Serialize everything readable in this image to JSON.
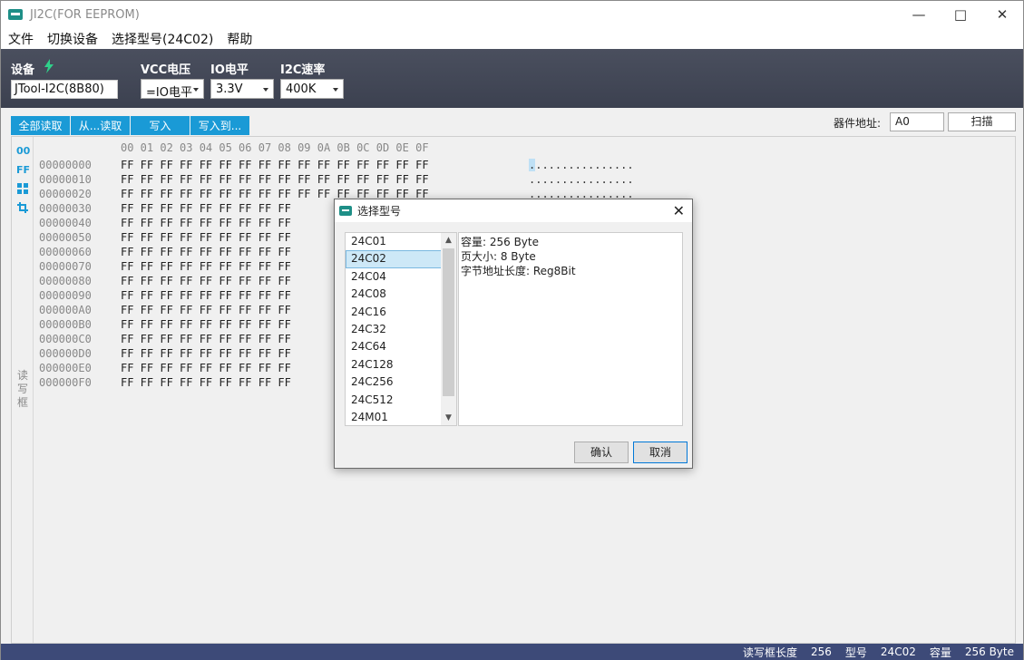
{
  "window": {
    "title": "JI2C(FOR EEPROM)"
  },
  "menu": [
    "文件",
    "切换设备",
    "选择型号(24C02)",
    "帮助"
  ],
  "toolbar": {
    "device_label": "设备",
    "device_value": "JTool-I2C(8B80)",
    "vcc_label": "VCC电压",
    "vcc_value": "=IO电平",
    "io_label": "IO电平",
    "io_value": "3.3V",
    "rate_label": "I2C速率",
    "rate_value": "400K"
  },
  "actions": {
    "read_all": "全部读取",
    "read_from": "从...读取",
    "write": "写入",
    "write_to": "写入到..."
  },
  "address": {
    "label": "器件地址:",
    "value": "A0",
    "scan": "扫描"
  },
  "side": {
    "ico1": "00",
    "ico2": "FF",
    "rw_box": "读写框"
  },
  "hex": {
    "header": "00 01 02 03 04 05 06 07 08 09 0A 0B 0C 0D 0E 0F",
    "rows": [
      {
        "addr": "00000000",
        "bytes": "FF FF FF FF FF FF FF FF FF FF FF FF FF FF FF FF",
        "ascii": "................"
      },
      {
        "addr": "00000010",
        "bytes": "FF FF FF FF FF FF FF FF FF FF FF FF FF FF FF FF",
        "ascii": "................"
      },
      {
        "addr": "00000020",
        "bytes": "FF FF FF FF FF FF FF FF FF FF FF FF FF FF FF FF",
        "ascii": "................"
      },
      {
        "addr": "00000030",
        "bytes": "FF FF FF FF FF FF FF FF FF",
        "ascii": ""
      },
      {
        "addr": "00000040",
        "bytes": "FF FF FF FF FF FF FF FF FF",
        "ascii": ""
      },
      {
        "addr": "00000050",
        "bytes": "FF FF FF FF FF FF FF FF FF",
        "ascii": ""
      },
      {
        "addr": "00000060",
        "bytes": "FF FF FF FF FF FF FF FF FF",
        "ascii": ""
      },
      {
        "addr": "00000070",
        "bytes": "FF FF FF FF FF FF FF FF FF",
        "ascii": ""
      },
      {
        "addr": "00000080",
        "bytes": "FF FF FF FF FF FF FF FF FF",
        "ascii": ""
      },
      {
        "addr": "00000090",
        "bytes": "FF FF FF FF FF FF FF FF FF",
        "ascii": ""
      },
      {
        "addr": "000000A0",
        "bytes": "FF FF FF FF FF FF FF FF FF",
        "ascii": ""
      },
      {
        "addr": "000000B0",
        "bytes": "FF FF FF FF FF FF FF FF FF",
        "ascii": ""
      },
      {
        "addr": "000000C0",
        "bytes": "FF FF FF FF FF FF FF FF FF",
        "ascii": ""
      },
      {
        "addr": "000000D0",
        "bytes": "FF FF FF FF FF FF FF FF FF",
        "ascii": ""
      },
      {
        "addr": "000000E0",
        "bytes": "FF FF FF FF FF FF FF FF FF",
        "ascii": ""
      },
      {
        "addr": "000000F0",
        "bytes": "FF FF FF FF FF FF FF FF FF",
        "ascii": ""
      }
    ]
  },
  "status": {
    "rw_len_label": "读写框长度",
    "rw_len": "256",
    "model_label": "型号",
    "model": "24C02",
    "cap_label": "容量",
    "cap": "256 Byte"
  },
  "dialog": {
    "title": "选择型号",
    "models": [
      "24C01",
      "24C02",
      "24C04",
      "24C08",
      "24C16",
      "24C32",
      "24C64",
      "24C128",
      "24C256",
      "24C512",
      "24M01"
    ],
    "selected": "24C02",
    "info": [
      "容量: 256 Byte",
      "页大小: 8 Byte",
      "字节地址长度: Reg8Bit"
    ],
    "ok": "确认",
    "cancel": "取消"
  },
  "colors": {
    "accent": "#1a9ad6",
    "toolbar": "#444958",
    "status": "#3d4a78"
  }
}
